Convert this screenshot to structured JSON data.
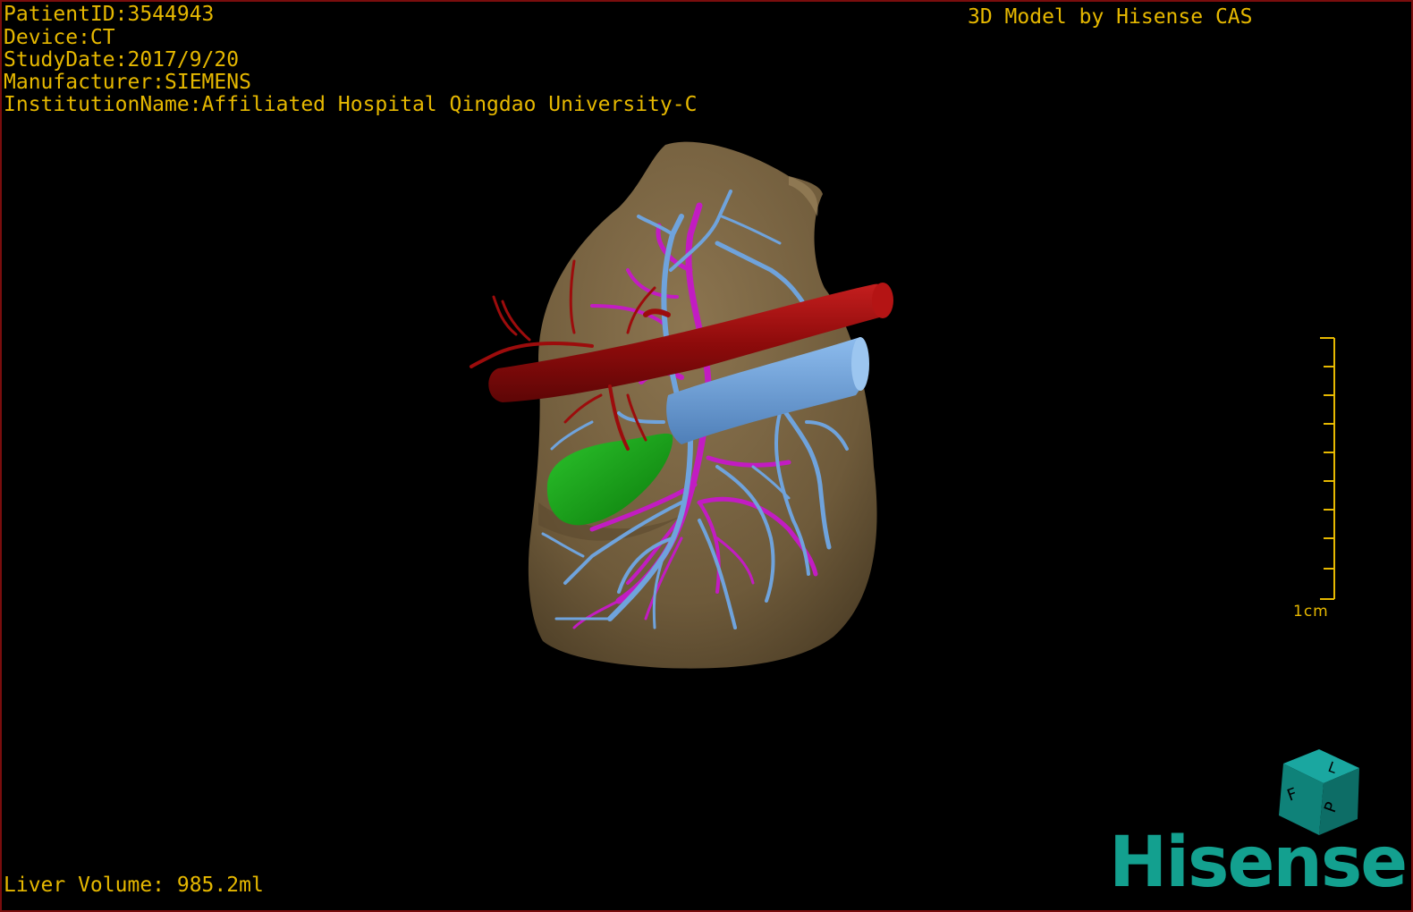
{
  "overlay": {
    "patient_id": "PatientID:3544943",
    "device": "Device:CT",
    "study_date": "StudyDate:2017/9/20",
    "manufacturer": "Manufacturer:SIEMENS",
    "institution": "InstitutionName:Affiliated Hospital Qingdao University-C",
    "watermark": "3D Model by Hisense CAS",
    "liver_volume": "Liver Volume: 985.2ml"
  },
  "scale": {
    "label": "1cm"
  },
  "orientation_cube": {
    "letters": [
      "F",
      "L",
      "P"
    ]
  },
  "brand": {
    "logo_text": "Hisense"
  },
  "colors": {
    "text": "#e6b800",
    "liver": "#7a6440",
    "hepatic_artery": "#9c0c0c",
    "portal_vein": "#6fa3dc",
    "hepatic_vein": "#c21cc2",
    "gallbladder": "#14a014",
    "brand": "#13a08f"
  }
}
